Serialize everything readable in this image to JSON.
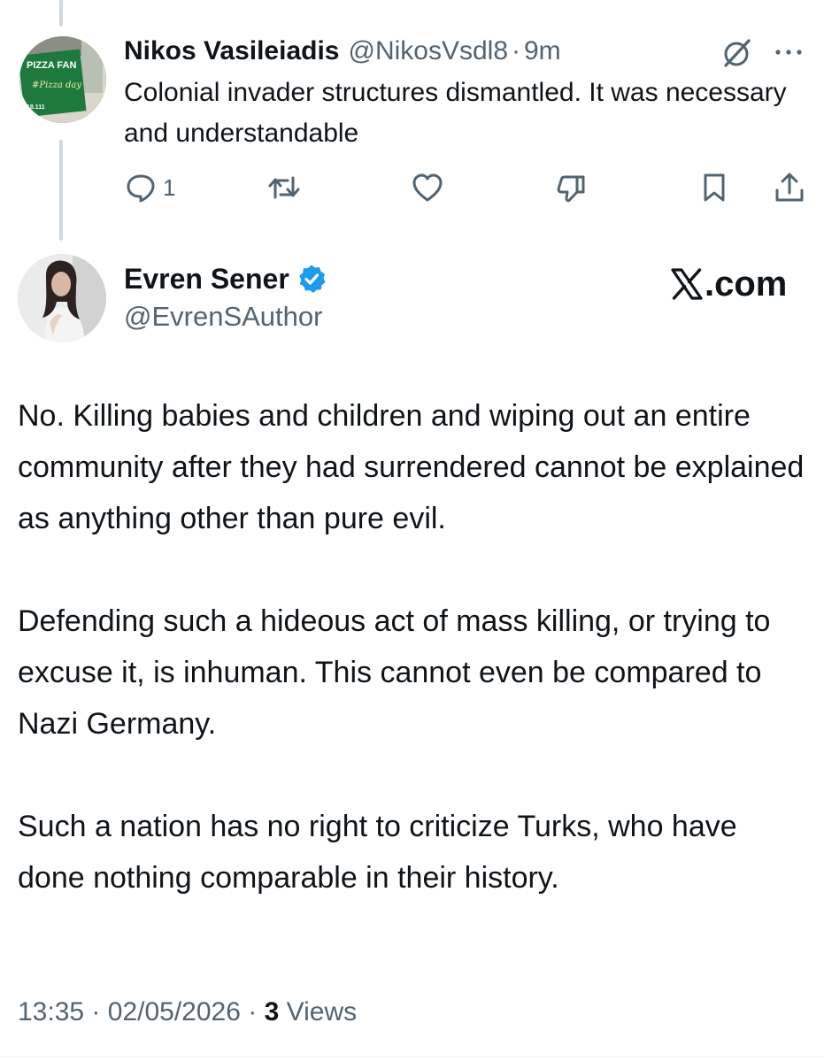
{
  "reply": {
    "author_name": "Nikos Vasileiadis",
    "handle": "@NikosVsdl8",
    "separator": "·",
    "time": "9m",
    "avatar_icon": "pizza-shop-avatar",
    "avatar_text": [
      "PIZZA FAN",
      "#Pizza day",
      "18.111"
    ],
    "text": "Colonial invader structures dismantled. It was necessary and understandable",
    "actions": {
      "reply_icon": "reply-icon",
      "reply_count": "1",
      "repost_icon": "repost-icon",
      "like_icon": "heart-icon",
      "dislike_icon": "thumbs-down-icon",
      "bookmark_icon": "bookmark-icon",
      "share_icon": "share-icon"
    },
    "grok_icon": "grok-icon",
    "more_icon": "more-icon"
  },
  "tweet": {
    "author_name": "Evren Sener",
    "verified_icon": "verified-badge-icon",
    "handle": "@EvrenSAuthor",
    "avatar_icon": "profile-photo-avatar",
    "brand": {
      "logo_icon": "x-logo-icon",
      "suffix": ".com"
    },
    "paragraphs": [
      "No. Killing babies and children and wiping out an entire community after they had surrendered cannot be explained as anything other than pure evil.",
      "Defending such a hideous act of mass killing, or trying to excuse it, is inhuman. This cannot even be compared to Nazi Germany.",
      "Such a nation has no right to criticize Turks, who have done nothing comparable in their history."
    ],
    "meta": {
      "time": "13:35",
      "separator": "·",
      "date": "02/05/2026",
      "views_count": "3",
      "views_label": "Views"
    }
  },
  "colors": {
    "text_primary": "#0f1419",
    "text_secondary": "#536471",
    "verified_blue": "#1d9bf0",
    "thread_line": "#cfd9de"
  }
}
